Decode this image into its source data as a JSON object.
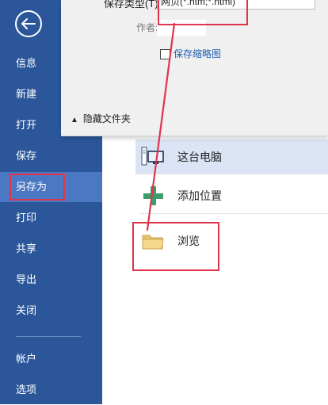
{
  "sidebar": {
    "items": [
      {
        "label": "信息"
      },
      {
        "label": "新建"
      },
      {
        "label": "打开"
      },
      {
        "label": "保存"
      },
      {
        "label": "另存为"
      },
      {
        "label": "打印"
      },
      {
        "label": "共享"
      },
      {
        "label": "导出"
      },
      {
        "label": "关闭"
      },
      {
        "label": "帐户"
      },
      {
        "label": "选项"
      }
    ],
    "active_index": 4,
    "background": "#2b579a",
    "active_background": "#4a78c2"
  },
  "dialog": {
    "save_type_label": "保存类型(T):",
    "save_type_value": "网页(*.htm;*.html)",
    "author_label": "作者:",
    "save_thumbnail_label": "保存缩略图",
    "save_thumbnail_checked": false,
    "hide_folders_label": "隐藏文件夹"
  },
  "locations": [
    {
      "label": "这台电脑",
      "icon": "computer-icon",
      "selected": true
    },
    {
      "label": "添加位置",
      "icon": "plus-icon",
      "selected": false
    },
    {
      "label": "浏览",
      "icon": "folder-icon",
      "selected": false
    }
  ],
  "annotation_color": "#e0334c"
}
